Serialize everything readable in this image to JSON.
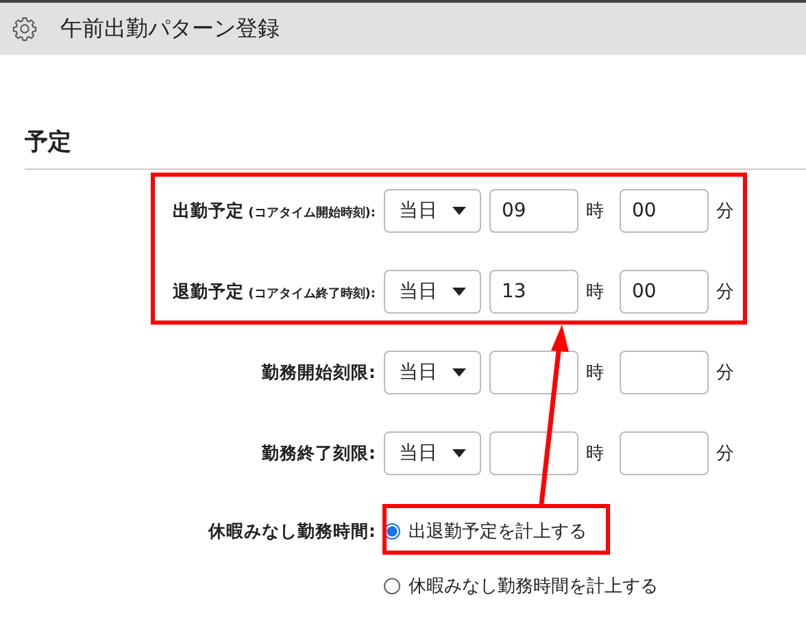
{
  "window": {
    "title": "午前出勤パターン登録"
  },
  "section": {
    "heading": "予定"
  },
  "rows": [
    {
      "label": "出勤予定",
      "note": "(コアタイム開始時刻):",
      "day": "当日",
      "hour": "09",
      "hour_unit": "時",
      "minute": "00",
      "minute_unit": "分"
    },
    {
      "label": "退勤予定",
      "note": "(コアタイム終了時刻):",
      "day": "当日",
      "hour": "13",
      "hour_unit": "時",
      "minute": "00",
      "minute_unit": "分"
    },
    {
      "label": "勤務開始刻限:",
      "day": "当日",
      "hour_unit": "時",
      "minute_unit": "分"
    },
    {
      "label": "勤務終了刻限:",
      "day": "当日",
      "hour_unit": "時",
      "minute_unit": "分"
    }
  ],
  "radio_group": {
    "label": "休暇みなし勤務時間:",
    "options": [
      {
        "label": "出退勤予定を計上する",
        "selected": true
      },
      {
        "label": "休暇みなし勤務時間を計上する",
        "selected": false
      }
    ]
  }
}
